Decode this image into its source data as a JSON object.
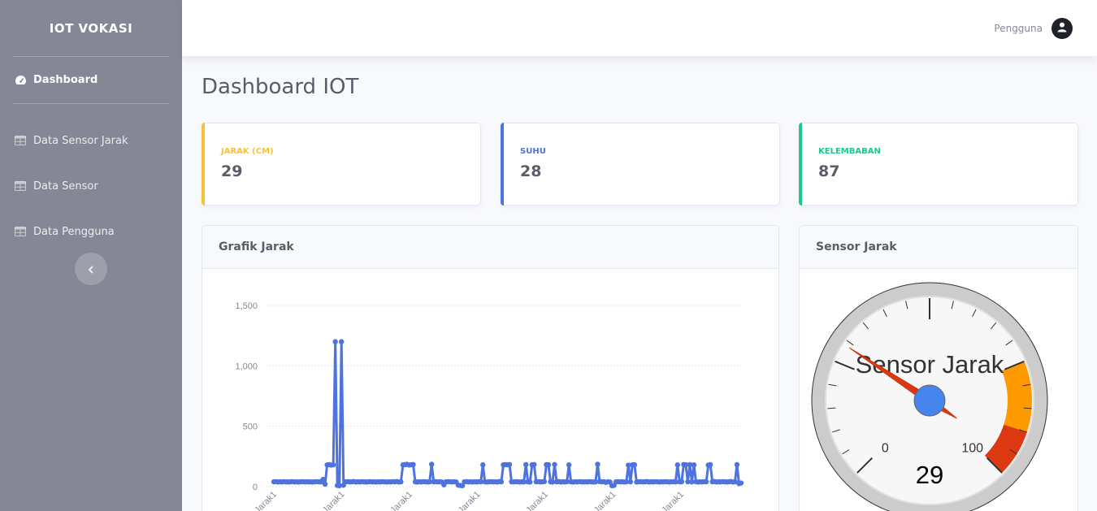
{
  "brand": "IOT VOKASI",
  "sidebar": {
    "items": [
      {
        "label": "Dashboard",
        "icon": "tachometer-icon"
      },
      {
        "label": "Data Sensor Jarak",
        "icon": "table-icon"
      },
      {
        "label": "Data Sensor",
        "icon": "table-icon"
      },
      {
        "label": "Data Pengguna",
        "icon": "table-icon"
      }
    ],
    "toggle_icon": "chevron-left-icon"
  },
  "topbar": {
    "user_name": "Pengguna",
    "avatar_icon": "user-icon"
  },
  "page_title": "Dashboard IOT",
  "stats": [
    {
      "label": "Jarak (cm)",
      "value": "29",
      "color": "#f6c23e"
    },
    {
      "label": "Suhu",
      "value": "28",
      "color": "#4e73df"
    },
    {
      "label": "Kelembaban",
      "value": "87",
      "color": "#1cc88a"
    }
  ],
  "chart_card": {
    "title": "Grafik Jarak"
  },
  "gauge_card": {
    "title": "Sensor Jarak"
  },
  "chart_data": [
    {
      "type": "line",
      "title": "Grafik Jarak",
      "color": "#4e73df",
      "ylim": [
        0,
        1500
      ],
      "yticks": [
        "0",
        "500",
        "1,000",
        "1,500"
      ],
      "ytick_values": [
        0,
        500,
        1000,
        1500
      ],
      "grid": true,
      "x_label_text": "Jarak1",
      "values": [
        40,
        41,
        38,
        40,
        39,
        41,
        40,
        38,
        40,
        41,
        39,
        40,
        38,
        40,
        41,
        39,
        40,
        40,
        39,
        38,
        40,
        41,
        39,
        40,
        60,
        20,
        180,
        182,
        178,
        181,
        1200,
        10,
        8,
        1200,
        12,
        40,
        41,
        39,
        40,
        42,
        38,
        40,
        39,
        41,
        40,
        38,
        40,
        41,
        39,
        40,
        38,
        40,
        39,
        41,
        40,
        38,
        40,
        39,
        41,
        40,
        42,
        38,
        40,
        180,
        182,
        185,
        179,
        181,
        183,
        40,
        38,
        40,
        39,
        41,
        40,
        38,
        40,
        185,
        40,
        41,
        39,
        40,
        38,
        15,
        40,
        41,
        40,
        39,
        40,
        38,
        12,
        10,
        8,
        40,
        41,
        39,
        40,
        38,
        40,
        39,
        41,
        40,
        180,
        40,
        38,
        40,
        41,
        39,
        40,
        38,
        42,
        40,
        180,
        182,
        181,
        183,
        40,
        39,
        41,
        40,
        38,
        40,
        39,
        182,
        40,
        38,
        181,
        183,
        40,
        41,
        39,
        40,
        42,
        182,
        181,
        40,
        38,
        183,
        40,
        42,
        38,
        40,
        39,
        41,
        180,
        40,
        38,
        40,
        39,
        41,
        40,
        38,
        40,
        39,
        41,
        40,
        38,
        40,
        185,
        42,
        40,
        41,
        35,
        40,
        38,
        8,
        10,
        40,
        41,
        39,
        40,
        38,
        40,
        178,
        40,
        180,
        181,
        38,
        40,
        41,
        39,
        40,
        42,
        38,
        40,
        39,
        41,
        40,
        38,
        40,
        39,
        41,
        40,
        38,
        40,
        41,
        39,
        180,
        40,
        40,
        183,
        181,
        40,
        182,
        39,
        180,
        40,
        38,
        40,
        39,
        41,
        40,
        178,
        182,
        40,
        42,
        38,
        40,
        39,
        41,
        40,
        38,
        40,
        42,
        38,
        40,
        182,
        25,
        30
      ]
    },
    {
      "type": "gauge",
      "title": "Sensor Jarak",
      "value": 29,
      "display_value": "29",
      "min": 0,
      "max": 100,
      "min_label": "0",
      "max_label": "100",
      "bands": [
        {
          "from": 75,
          "to": 90,
          "color": "#ff9900"
        },
        {
          "from": 90,
          "to": 100,
          "color": "#dc3912"
        }
      ]
    }
  ]
}
